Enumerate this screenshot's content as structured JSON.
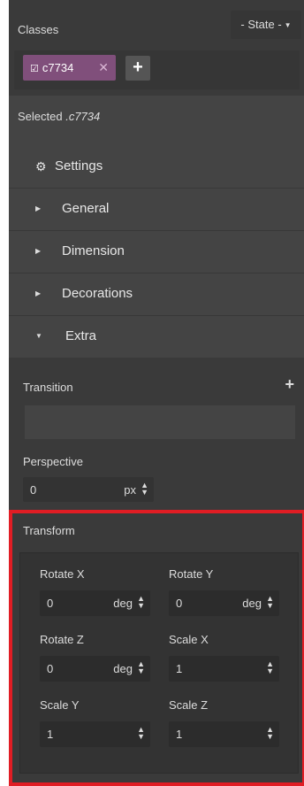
{
  "classes": {
    "title": "Classes",
    "state_label": "- State -",
    "tag_label": "c7734",
    "tag_check_glyph": "☑",
    "tag_close_glyph": "✕",
    "add_glyph": "+"
  },
  "selected": {
    "prefix": "Selected ",
    "name": ".c7734"
  },
  "settings": {
    "label": "Settings"
  },
  "sectors": [
    {
      "label": "General",
      "open": false
    },
    {
      "label": "Dimension",
      "open": false
    },
    {
      "label": "Decorations",
      "open": false
    },
    {
      "label": "Extra",
      "open": true
    }
  ],
  "extra": {
    "transition_label": "Transition",
    "transition_add_glyph": "+",
    "perspective_label": "Perspective",
    "perspective_value": "0",
    "perspective_unit": "px"
  },
  "transform": {
    "label": "Transform",
    "highlight_color": "#e01d24",
    "rotate_x": {
      "label": "Rotate X",
      "value": "0",
      "unit": "deg"
    },
    "rotate_y": {
      "label": "Rotate Y",
      "value": "0",
      "unit": "deg"
    },
    "rotate_z": {
      "label": "Rotate Z",
      "value": "0",
      "unit": "deg"
    },
    "scale_x": {
      "label": "Scale X",
      "value": "1",
      "unit": ""
    },
    "scale_y": {
      "label": "Scale Y",
      "value": "1",
      "unit": ""
    },
    "scale_z": {
      "label": "Scale Z",
      "value": "1",
      "unit": ""
    }
  },
  "glyphs": {
    "spin": "▲▼",
    "caret": "▼",
    "arrow_right": "▶",
    "arrow_down": "▼",
    "gear": "⚙"
  }
}
